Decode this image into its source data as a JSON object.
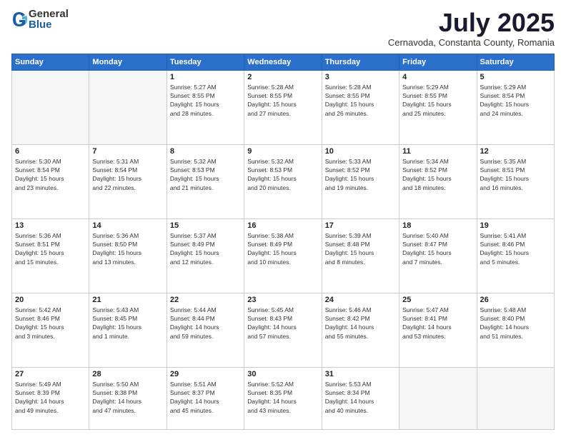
{
  "logo": {
    "general": "General",
    "blue": "Blue"
  },
  "title": {
    "month": "July 2025",
    "location": "Cernavoda, Constanta County, Romania"
  },
  "weekdays": [
    "Sunday",
    "Monday",
    "Tuesday",
    "Wednesday",
    "Thursday",
    "Friday",
    "Saturday"
  ],
  "weeks": [
    [
      {
        "day": "",
        "info": ""
      },
      {
        "day": "",
        "info": ""
      },
      {
        "day": "1",
        "info": "Sunrise: 5:27 AM\nSunset: 8:55 PM\nDaylight: 15 hours\nand 28 minutes."
      },
      {
        "day": "2",
        "info": "Sunrise: 5:28 AM\nSunset: 8:55 PM\nDaylight: 15 hours\nand 27 minutes."
      },
      {
        "day": "3",
        "info": "Sunrise: 5:28 AM\nSunset: 8:55 PM\nDaylight: 15 hours\nand 26 minutes."
      },
      {
        "day": "4",
        "info": "Sunrise: 5:29 AM\nSunset: 8:55 PM\nDaylight: 15 hours\nand 25 minutes."
      },
      {
        "day": "5",
        "info": "Sunrise: 5:29 AM\nSunset: 8:54 PM\nDaylight: 15 hours\nand 24 minutes."
      }
    ],
    [
      {
        "day": "6",
        "info": "Sunrise: 5:30 AM\nSunset: 8:54 PM\nDaylight: 15 hours\nand 23 minutes."
      },
      {
        "day": "7",
        "info": "Sunrise: 5:31 AM\nSunset: 8:54 PM\nDaylight: 15 hours\nand 22 minutes."
      },
      {
        "day": "8",
        "info": "Sunrise: 5:32 AM\nSunset: 8:53 PM\nDaylight: 15 hours\nand 21 minutes."
      },
      {
        "day": "9",
        "info": "Sunrise: 5:32 AM\nSunset: 8:53 PM\nDaylight: 15 hours\nand 20 minutes."
      },
      {
        "day": "10",
        "info": "Sunrise: 5:33 AM\nSunset: 8:52 PM\nDaylight: 15 hours\nand 19 minutes."
      },
      {
        "day": "11",
        "info": "Sunrise: 5:34 AM\nSunset: 8:52 PM\nDaylight: 15 hours\nand 18 minutes."
      },
      {
        "day": "12",
        "info": "Sunrise: 5:35 AM\nSunset: 8:51 PM\nDaylight: 15 hours\nand 16 minutes."
      }
    ],
    [
      {
        "day": "13",
        "info": "Sunrise: 5:36 AM\nSunset: 8:51 PM\nDaylight: 15 hours\nand 15 minutes."
      },
      {
        "day": "14",
        "info": "Sunrise: 5:36 AM\nSunset: 8:50 PM\nDaylight: 15 hours\nand 13 minutes."
      },
      {
        "day": "15",
        "info": "Sunrise: 5:37 AM\nSunset: 8:49 PM\nDaylight: 15 hours\nand 12 minutes."
      },
      {
        "day": "16",
        "info": "Sunrise: 5:38 AM\nSunset: 8:49 PM\nDaylight: 15 hours\nand 10 minutes."
      },
      {
        "day": "17",
        "info": "Sunrise: 5:39 AM\nSunset: 8:48 PM\nDaylight: 15 hours\nand 8 minutes."
      },
      {
        "day": "18",
        "info": "Sunrise: 5:40 AM\nSunset: 8:47 PM\nDaylight: 15 hours\nand 7 minutes."
      },
      {
        "day": "19",
        "info": "Sunrise: 5:41 AM\nSunset: 8:46 PM\nDaylight: 15 hours\nand 5 minutes."
      }
    ],
    [
      {
        "day": "20",
        "info": "Sunrise: 5:42 AM\nSunset: 8:46 PM\nDaylight: 15 hours\nand 3 minutes."
      },
      {
        "day": "21",
        "info": "Sunrise: 5:43 AM\nSunset: 8:45 PM\nDaylight: 15 hours\nand 1 minute."
      },
      {
        "day": "22",
        "info": "Sunrise: 5:44 AM\nSunset: 8:44 PM\nDaylight: 14 hours\nand 59 minutes."
      },
      {
        "day": "23",
        "info": "Sunrise: 5:45 AM\nSunset: 8:43 PM\nDaylight: 14 hours\nand 57 minutes."
      },
      {
        "day": "24",
        "info": "Sunrise: 5:46 AM\nSunset: 8:42 PM\nDaylight: 14 hours\nand 55 minutes."
      },
      {
        "day": "25",
        "info": "Sunrise: 5:47 AM\nSunset: 8:41 PM\nDaylight: 14 hours\nand 53 minutes."
      },
      {
        "day": "26",
        "info": "Sunrise: 5:48 AM\nSunset: 8:40 PM\nDaylight: 14 hours\nand 51 minutes."
      }
    ],
    [
      {
        "day": "27",
        "info": "Sunrise: 5:49 AM\nSunset: 8:39 PM\nDaylight: 14 hours\nand 49 minutes."
      },
      {
        "day": "28",
        "info": "Sunrise: 5:50 AM\nSunset: 8:38 PM\nDaylight: 14 hours\nand 47 minutes."
      },
      {
        "day": "29",
        "info": "Sunrise: 5:51 AM\nSunset: 8:37 PM\nDaylight: 14 hours\nand 45 minutes."
      },
      {
        "day": "30",
        "info": "Sunrise: 5:52 AM\nSunset: 8:35 PM\nDaylight: 14 hours\nand 43 minutes."
      },
      {
        "day": "31",
        "info": "Sunrise: 5:53 AM\nSunset: 8:34 PM\nDaylight: 14 hours\nand 40 minutes."
      },
      {
        "day": "",
        "info": ""
      },
      {
        "day": "",
        "info": ""
      }
    ]
  ]
}
